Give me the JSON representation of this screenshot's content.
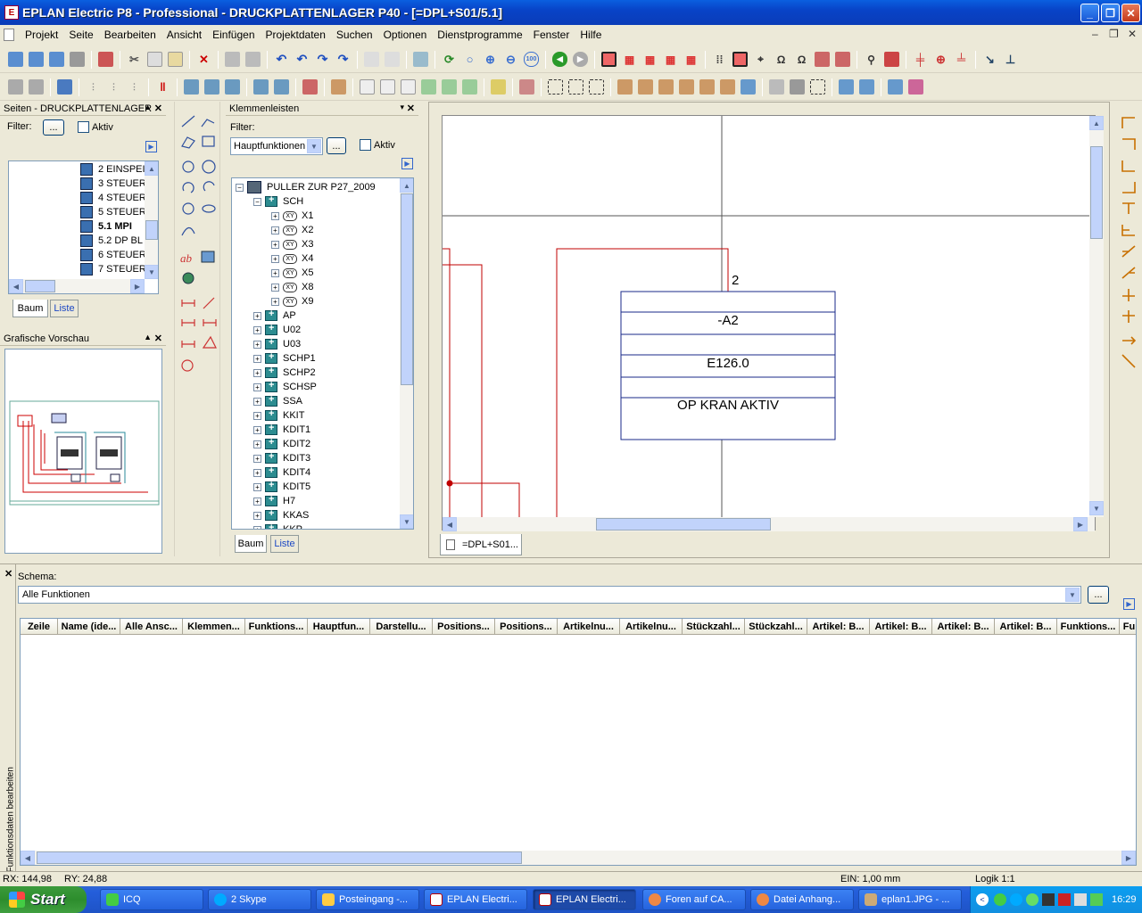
{
  "window": {
    "title": "EPLAN Electric P8 - Professional - DRUCKPLATTENLAGER P40 - [=DPL+S01/5.1]"
  },
  "menu": [
    "Projekt",
    "Seite",
    "Bearbeiten",
    "Ansicht",
    "Einfügen",
    "Projektdaten",
    "Suchen",
    "Optionen",
    "Dienstprogramme",
    "Fenster",
    "Hilfe"
  ],
  "pages_panel": {
    "title": "Seiten - DRUCKPLATTENLAGER",
    "filter_label": "Filter:",
    "filter_button": "...",
    "aktiv_label": "Aktiv",
    "items": [
      "2 EINSPEI",
      "3 STEUER",
      "4 STEUER",
      "5 STEUER",
      "5.1 MPI",
      "5.2 DP BL",
      "6 STEUER",
      "7 STEUER"
    ],
    "tab_baum": "Baum",
    "tab_liste": "Liste"
  },
  "preview_panel": {
    "title": "Grafische Vorschau"
  },
  "terminal_panel": {
    "title": "Klemmenleisten",
    "filter_label": "Filter:",
    "filter_value": "Hauptfunktionen",
    "filter_button": "...",
    "aktiv_label": "Aktiv",
    "root": "PULLER ZUR P27_2009",
    "group": "SCH",
    "xy_items": [
      "X1",
      "X2",
      "X3",
      "X4",
      "X5",
      "X8",
      "X9"
    ],
    "groups": [
      "AP",
      "U02",
      "U03",
      "SCHP1",
      "SCHP2",
      "SCHSP",
      "SSA",
      "KKIT",
      "KDIT1",
      "KDIT2",
      "KDIT3",
      "KDIT4",
      "KDIT5",
      "H7",
      "KKAS",
      "KKP"
    ],
    "tab_baum": "Baum",
    "tab_liste": "Liste"
  },
  "drawing": {
    "tab_label": "=DPL+S01...",
    "box_number": "2",
    "box_name": "-A2",
    "box_address": "E126.0",
    "box_text": "OP KRAN AKTIV"
  },
  "function_panel": {
    "side_label": "Funktionsdaten bearbeiten",
    "schema_label": "Schema:",
    "schema_value": "Alle Funktionen",
    "schema_button": "...",
    "columns": [
      "Zeile",
      "Name (ide...",
      "Alle Ansc...",
      "Klemmen...",
      "Funktions...",
      "Hauptfun...",
      "Darstellu...",
      "Positions...",
      "Positions...",
      "Artikelnu...",
      "Artikelnu...",
      "Stückzahl...",
      "Stückzahl...",
      "Artikel: B...",
      "Artikel: B...",
      "Artikel: B...",
      "Artikel: B...",
      "Funktions...",
      "Fu"
    ]
  },
  "status": {
    "rx": "RX: 144,98",
    "ry": "RY: 24,88",
    "ein": "EIN: 1,00 mm",
    "logik": "Logik 1:1"
  },
  "taskbar": {
    "start": "Start",
    "tasks": [
      "ICQ",
      "2 Skype",
      "Posteingang -...",
      "EPLAN Electri...",
      "EPLAN Electri...",
      "Foren auf CA...",
      "Datei Anhang...",
      "eplan1.JPG - ..."
    ],
    "time": "16:29"
  },
  "colors": {
    "title_blue": "#0a46c8",
    "wire_red": "#c00000",
    "box_blue": "#1a2a8a"
  }
}
